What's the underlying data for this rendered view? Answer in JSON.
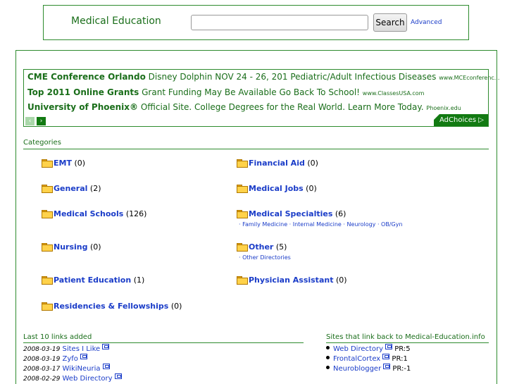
{
  "header": {
    "site_title": "Medical Education",
    "search_value": "",
    "search_button": "Search",
    "advanced_link": "Advanced"
  },
  "ads": {
    "items": [
      {
        "title": "CME Conference Orlando",
        "desc": "Disney Dolphin NOV 24 - 26, 201 Pediatric/Adult Infectious Diseases",
        "url": "www.MCEconferenc..."
      },
      {
        "title": "Top 2011 Online Grants",
        "desc": "Grant Funding May Be Available Go Back To School!",
        "url": "www.ClassesUSA.com"
      },
      {
        "title": "University of Phoenix®",
        "desc": "Official Site. College Degrees for the Real World. Learn More Today.",
        "url": "Phoenix.edu"
      }
    ],
    "prev_glyph": "‹",
    "next_glyph": "›",
    "adchoices": "AdChoices ▷"
  },
  "categories": {
    "label": "Categories",
    "items": [
      {
        "name": "EMT",
        "count": "(0)"
      },
      {
        "name": "Financial Aid",
        "count": "(0)"
      },
      {
        "name": "General",
        "count": "(2)"
      },
      {
        "name": "Medical Jobs",
        "count": "(0)"
      },
      {
        "name": "Medical Schools",
        "count": "(126)"
      },
      {
        "name": "Medical Specialties",
        "count": "(6)",
        "subs": "· Family Medicine · Internal Medicine · Neurology · OB/Gyn"
      },
      {
        "name": "Nursing",
        "count": "(0)"
      },
      {
        "name": "Other",
        "count": "(5)",
        "subs": "· Other Directories"
      },
      {
        "name": "Patient Education",
        "count": "(1)"
      },
      {
        "name": "Physician Assistant",
        "count": "(0)"
      },
      {
        "name": "Residencies & Fellowships",
        "count": "(0)"
      }
    ]
  },
  "last_links": {
    "label": "Last 10 links added",
    "items": [
      {
        "date": "2008-03-19",
        "title": "Sites I Like"
      },
      {
        "date": "2008-03-19",
        "title": "Zyfo"
      },
      {
        "date": "2008-03-17",
        "title": "WikiNeuria"
      },
      {
        "date": "2008-02-29",
        "title": "Web Directory"
      }
    ]
  },
  "backlinks": {
    "label": "Sites that link back to Medical-Education.info",
    "items": [
      {
        "title": "Web Directory",
        "pr": "PR:5"
      },
      {
        "title": "FrontalCortex",
        "pr": "PR:1"
      },
      {
        "title": "Neuroblogger",
        "pr": "PR:-1"
      }
    ]
  },
  "colors": {
    "accent_green": "#2e8b2e",
    "dark_green": "#127a12",
    "link_blue": "#1a3cc8",
    "folder_yellow": "#ffd24a"
  }
}
